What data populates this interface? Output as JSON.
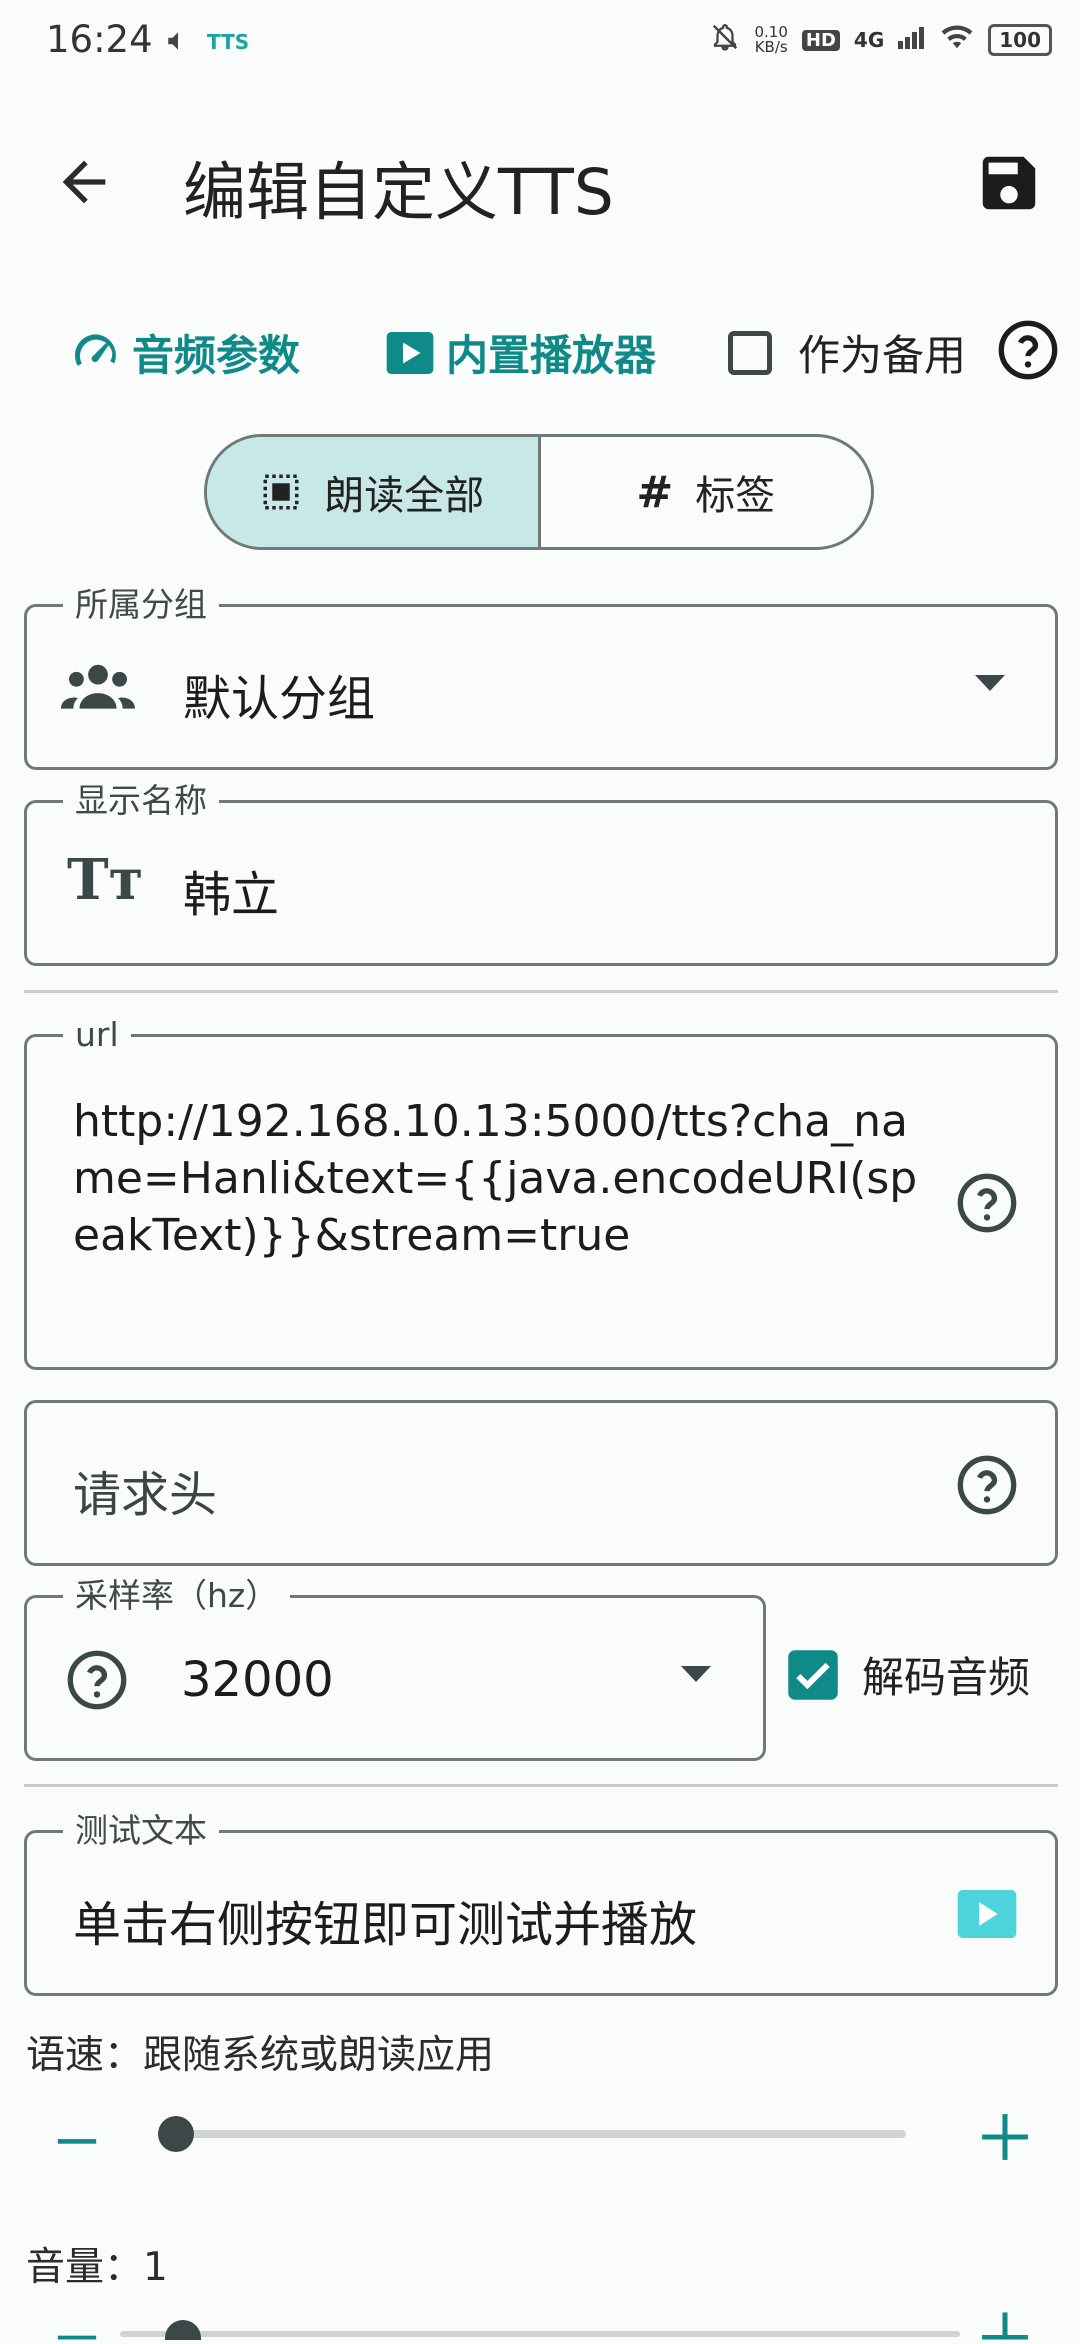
{
  "status": {
    "time": "16:24",
    "net_speed": "0.10\nKB/s",
    "hd": "HD",
    "net": "4G",
    "battery": "100"
  },
  "toolbar": {
    "title": "编辑自定义TTS"
  },
  "chips": {
    "audio_params": "音频参数",
    "builtin_player": "内置播放器",
    "as_backup": "作为备用"
  },
  "segments": {
    "read_all": "朗读全部",
    "tags": "标签"
  },
  "group": {
    "label": "所属分组",
    "value": "默认分组"
  },
  "display_name": {
    "label": "显示名称",
    "value": "韩立"
  },
  "url": {
    "label": "url",
    "value": "http://192.168.10.13:5000/tts?cha_name=Hanli&text={{java.encodeURI(speakText)}}&stream=true"
  },
  "headers": {
    "placeholder": "请求头"
  },
  "sample_rate": {
    "label": "采样率（hz）",
    "value": "32000"
  },
  "decode_audio": {
    "label": "解码音频",
    "checked": true
  },
  "test_text": {
    "label": "测试文本",
    "value": "单击右侧按钮即可测试并播放"
  },
  "speech_rate": {
    "label": "语速：跟随系统或朗读应用",
    "level": 0
  },
  "volume": {
    "label": "音量：1"
  },
  "colors": {
    "accent": "#0f8a89",
    "segment_active": "#c8e8e8",
    "play_button": "#4dd3dc"
  }
}
